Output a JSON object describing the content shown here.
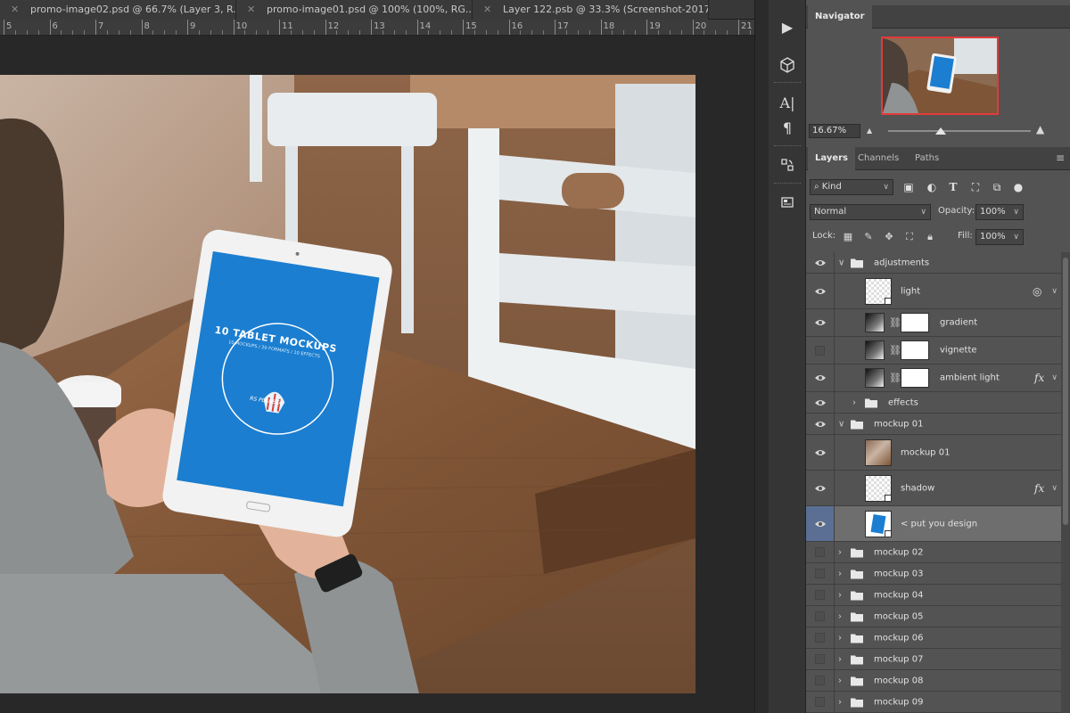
{
  "document_tabs": [
    {
      "label": "promo-image02.psd @ 66.7% (Layer 3, R..."
    },
    {
      "label": "promo-image01.psd @ 100% (100%, RG..."
    },
    {
      "label": "Layer 122.psb @ 33.3% (Screenshot-2017..."
    }
  ],
  "ruler_numbers": [
    "5",
    "6",
    "7",
    "8",
    "9",
    "10",
    "11",
    "12",
    "13",
    "14",
    "15",
    "16",
    "17",
    "18",
    "19",
    "20",
    "21"
  ],
  "tablet_screen": {
    "title": "10 TABLET MOCKUPS",
    "subtitle": "10 MOCKUPS / 20 FORMATS / 10 EFFECTS",
    "brand": "RS PLANETA"
  },
  "navigator": {
    "title": "Navigator",
    "zoom": "16.67%"
  },
  "layers_panel": {
    "tabs": [
      "Layers",
      "Channels",
      "Paths"
    ],
    "kind_filter": "Kind",
    "blend_mode": "Normal",
    "opacity_label": "Opacity:",
    "opacity_value": "100%",
    "lock_label": "Lock:",
    "fill_label": "Fill:",
    "fill_value": "100%"
  },
  "layers": [
    {
      "name": "adjustments",
      "type": "group",
      "visible": true,
      "expanded": true
    },
    {
      "name": "light",
      "type": "smart",
      "visible": true
    },
    {
      "name": "gradient",
      "type": "adjustment",
      "visible": true
    },
    {
      "name": "vignette",
      "type": "adjustment",
      "visible": false
    },
    {
      "name": "ambient light",
      "type": "adjustment",
      "visible": true,
      "fx": true
    },
    {
      "name": "effects",
      "type": "group",
      "visible": true,
      "expanded": false
    },
    {
      "name": "mockup 01",
      "type": "group",
      "visible": true,
      "expanded": true
    },
    {
      "name": "mockup 01",
      "type": "image",
      "visible": true
    },
    {
      "name": "shadow",
      "type": "smart",
      "visible": true,
      "fx": true
    },
    {
      "name": "< put you design",
      "type": "smart",
      "visible": true,
      "selected": true
    },
    {
      "name": "mockup 02",
      "type": "group",
      "visible": false
    },
    {
      "name": "mockup 03",
      "type": "group",
      "visible": false
    },
    {
      "name": "mockup 04",
      "type": "group",
      "visible": false
    },
    {
      "name": "mockup 05",
      "type": "group",
      "visible": false
    },
    {
      "name": "mockup 06",
      "type": "group",
      "visible": false
    },
    {
      "name": "mockup 07",
      "type": "group",
      "visible": false
    },
    {
      "name": "mockup 08",
      "type": "group",
      "visible": false
    },
    {
      "name": "mockup 09",
      "type": "group",
      "visible": false
    }
  ],
  "colors": {
    "tablet_screen_blue": "#1b7ed0",
    "selection_blue": "#5a6f93",
    "navigator_frame": "#e23b3b"
  }
}
